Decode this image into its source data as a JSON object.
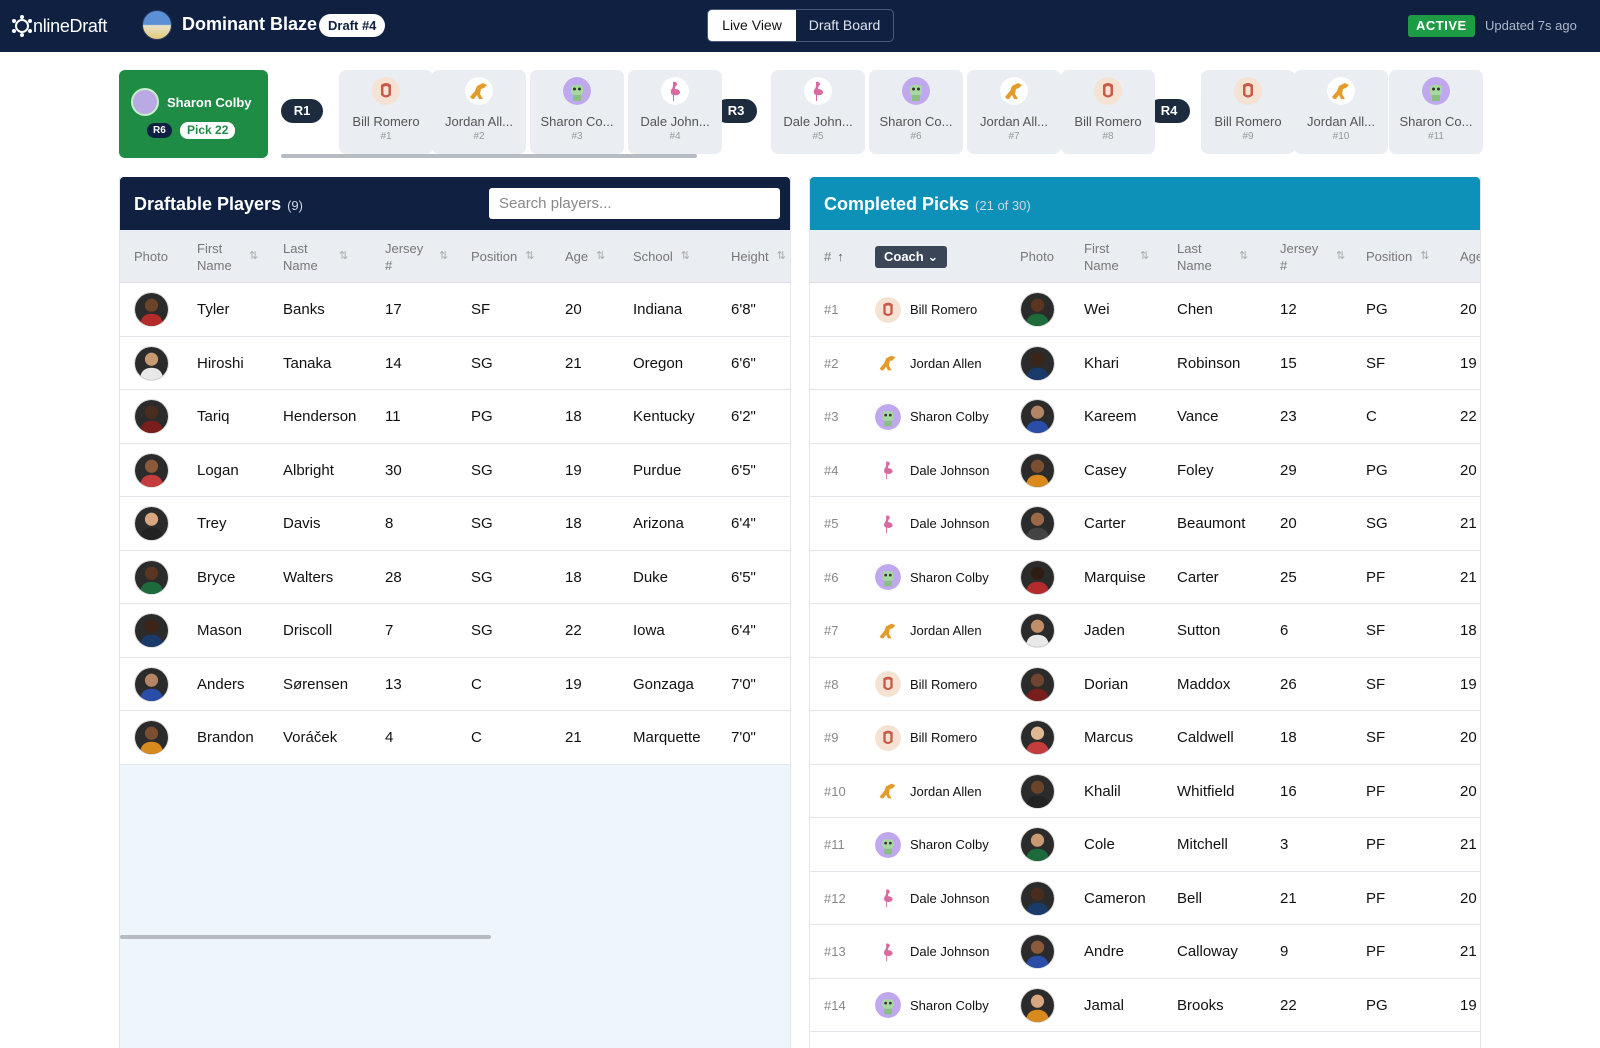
{
  "app": {
    "logo_text": "nlineDraft",
    "team_name": "Dominant Blaze",
    "draft_badge": "Draft #4"
  },
  "view_toggle": {
    "live": "Live View",
    "board": "Draft Board"
  },
  "status": {
    "badge": "ACTIVE",
    "updated": "Updated 7s ago",
    "badge_color": "#1e9c45"
  },
  "current_pick": {
    "coach": "Sharon Colby",
    "round": "R6",
    "pick": "Pick 22"
  },
  "pick_strip": {
    "rounds": [
      "R1",
      "R3",
      "R4"
    ],
    "picks": [
      {
        "name": "Bill Romero",
        "no": "#1",
        "avatar": "shield-icon"
      },
      {
        "name": "Jordan All...",
        "no": "#2",
        "avatar": "dinosaur-icon"
      },
      {
        "name": "Sharon Co...",
        "no": "#3",
        "avatar": "robot-icon"
      },
      {
        "name": "Dale John...",
        "no": "#4",
        "avatar": "flamingo-icon"
      },
      {
        "name": "Dale John...",
        "no": "#5",
        "avatar": "flamingo-icon"
      },
      {
        "name": "Sharon Co...",
        "no": "#6",
        "avatar": "robot-icon"
      },
      {
        "name": "Jordan All...",
        "no": "#7",
        "avatar": "dinosaur-icon"
      },
      {
        "name": "Bill Romero",
        "no": "#8",
        "avatar": "shield-icon"
      },
      {
        "name": "Bill Romero",
        "no": "#9",
        "avatar": "shield-icon"
      },
      {
        "name": "Jordan All...",
        "no": "#10",
        "avatar": "dinosaur-icon"
      },
      {
        "name": "Sharon Co...",
        "no": "#11",
        "avatar": "robot-icon"
      }
    ]
  },
  "draftable": {
    "title": "Draftable Players",
    "count": "(9)",
    "search_placeholder": "Search players...",
    "columns": [
      "Photo",
      "First Name",
      "Last Name",
      "Jersey #",
      "Position",
      "Age",
      "School",
      "Height"
    ],
    "rows": [
      {
        "first": "Tyler",
        "last": "Banks",
        "jersey": "17",
        "pos": "SF",
        "age": "20",
        "school": "Indiana",
        "height": "6'8\""
      },
      {
        "first": "Hiroshi",
        "last": "Tanaka",
        "jersey": "14",
        "pos": "SG",
        "age": "21",
        "school": "Oregon",
        "height": "6'6\""
      },
      {
        "first": "Tariq",
        "last": "Henderson",
        "jersey": "11",
        "pos": "PG",
        "age": "18",
        "school": "Kentucky",
        "height": "6'2\""
      },
      {
        "first": "Logan",
        "last": "Albright",
        "jersey": "30",
        "pos": "SG",
        "age": "19",
        "school": "Purdue",
        "height": "6'5\""
      },
      {
        "first": "Trey",
        "last": "Davis",
        "jersey": "8",
        "pos": "SG",
        "age": "18",
        "school": "Arizona",
        "height": "6'4\""
      },
      {
        "first": "Bryce",
        "last": "Walters",
        "jersey": "28",
        "pos": "SG",
        "age": "18",
        "school": "Duke",
        "height": "6'5\""
      },
      {
        "first": "Mason",
        "last": "Driscoll",
        "jersey": "7",
        "pos": "SG",
        "age": "22",
        "school": "Iowa",
        "height": "6'4\""
      },
      {
        "first": "Anders",
        "last": "Sørensen",
        "jersey": "13",
        "pos": "C",
        "age": "19",
        "school": "Gonzaga",
        "height": "7'0\""
      },
      {
        "first": "Brandon",
        "last": "Voráček",
        "jersey": "4",
        "pos": "C",
        "age": "21",
        "school": "Marquette",
        "height": "7'0\""
      }
    ]
  },
  "completed": {
    "title": "Completed Picks",
    "count": "(21 of 30)",
    "columns": [
      "#",
      "Coach",
      "Photo",
      "First Name",
      "Last Name",
      "Jersey #",
      "Position",
      "Age"
    ],
    "rows": [
      {
        "no": "#1",
        "coach": "Bill Romero",
        "avatar": "shield-icon",
        "first": "Wei",
        "last": "Chen",
        "jersey": "12",
        "pos": "PG",
        "age": "20"
      },
      {
        "no": "#2",
        "coach": "Jordan Allen",
        "avatar": "dinosaur-icon",
        "first": "Khari",
        "last": "Robinson",
        "jersey": "15",
        "pos": "SF",
        "age": "19"
      },
      {
        "no": "#3",
        "coach": "Sharon Colby",
        "avatar": "robot-icon",
        "first": "Kareem",
        "last": "Vance",
        "jersey": "23",
        "pos": "C",
        "age": "22"
      },
      {
        "no": "#4",
        "coach": "Dale Johnson",
        "avatar": "flamingo-icon",
        "first": "Casey",
        "last": "Foley",
        "jersey": "29",
        "pos": "PG",
        "age": "20"
      },
      {
        "no": "#5",
        "coach": "Dale Johnson",
        "avatar": "flamingo-icon",
        "first": "Carter",
        "last": "Beaumont",
        "jersey": "20",
        "pos": "SG",
        "age": "21"
      },
      {
        "no": "#6",
        "coach": "Sharon Colby",
        "avatar": "robot-icon",
        "first": "Marquise",
        "last": "Carter",
        "jersey": "25",
        "pos": "PF",
        "age": "21"
      },
      {
        "no": "#7",
        "coach": "Jordan Allen",
        "avatar": "dinosaur-icon",
        "first": "Jaden",
        "last": "Sutton",
        "jersey": "6",
        "pos": "SF",
        "age": "18"
      },
      {
        "no": "#8",
        "coach": "Bill Romero",
        "avatar": "shield-icon",
        "first": "Dorian",
        "last": "Maddox",
        "jersey": "26",
        "pos": "SF",
        "age": "19"
      },
      {
        "no": "#9",
        "coach": "Bill Romero",
        "avatar": "shield-icon",
        "first": "Marcus",
        "last": "Caldwell",
        "jersey": "18",
        "pos": "SF",
        "age": "20"
      },
      {
        "no": "#10",
        "coach": "Jordan Allen",
        "avatar": "dinosaur-icon",
        "first": "Khalil",
        "last": "Whitfield",
        "jersey": "16",
        "pos": "PF",
        "age": "20"
      },
      {
        "no": "#11",
        "coach": "Sharon Colby",
        "avatar": "robot-icon",
        "first": "Cole",
        "last": "Mitchell",
        "jersey": "3",
        "pos": "PF",
        "age": "21"
      },
      {
        "no": "#12",
        "coach": "Dale Johnson",
        "avatar": "flamingo-icon",
        "first": "Cameron",
        "last": "Bell",
        "jersey": "21",
        "pos": "PF",
        "age": "20"
      },
      {
        "no": "#13",
        "coach": "Dale Johnson",
        "avatar": "flamingo-icon",
        "first": "Andre",
        "last": "Calloway",
        "jersey": "9",
        "pos": "PF",
        "age": "21"
      },
      {
        "no": "#14",
        "coach": "Sharon Colby",
        "avatar": "robot-icon",
        "first": "Jamal",
        "last": "Brooks",
        "jersey": "22",
        "pos": "PG",
        "age": "19"
      }
    ]
  }
}
